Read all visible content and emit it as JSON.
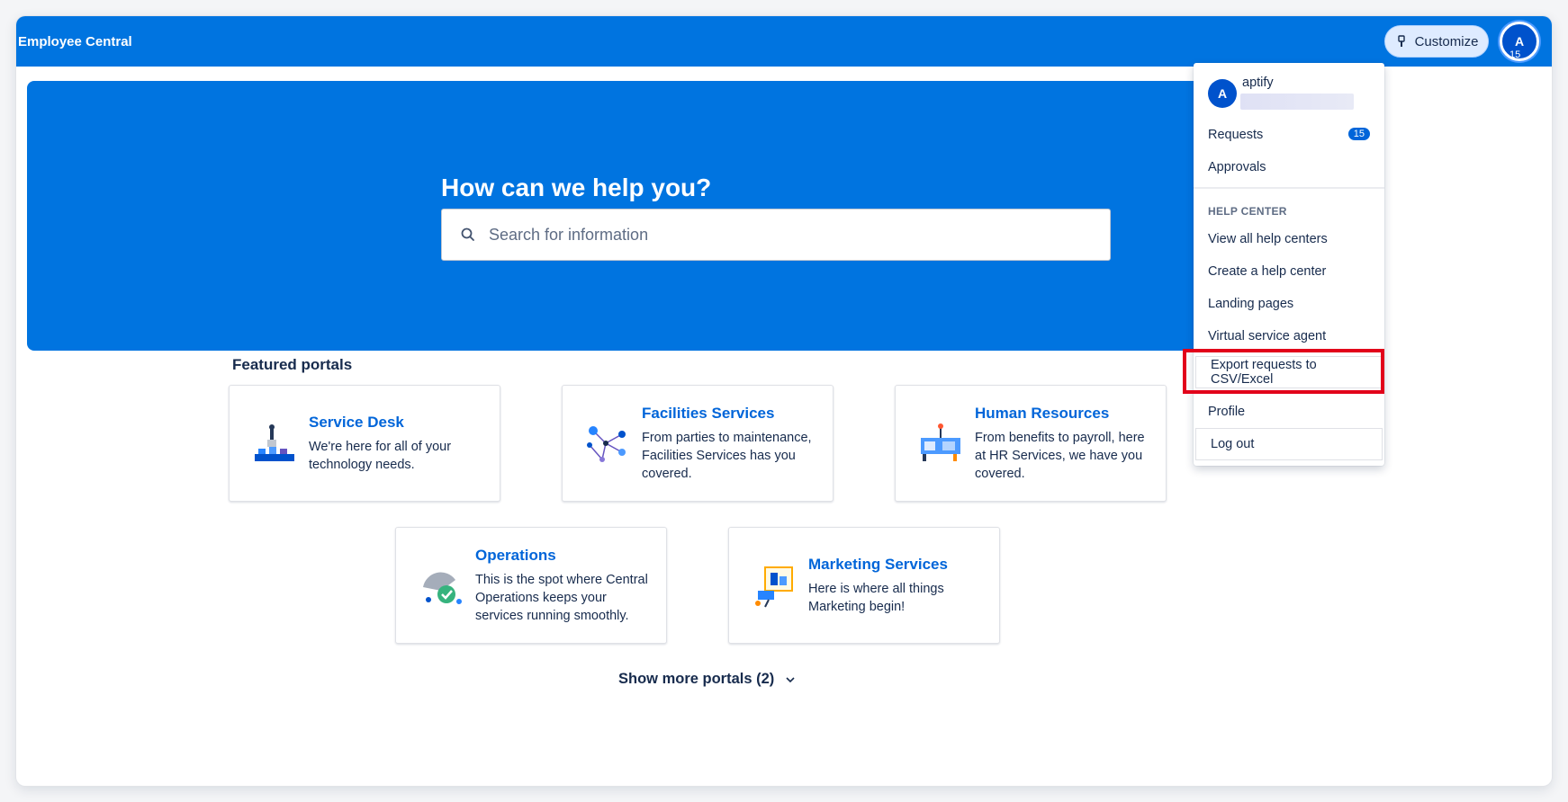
{
  "topbar": {
    "brand": "Employee Central",
    "customize_label": "Customize",
    "avatar_letter": "A",
    "avatar_count": "15"
  },
  "hero": {
    "title": "How can we help you?",
    "search_placeholder": "Search for information"
  },
  "featured": {
    "title": "Featured portals",
    "portals": [
      {
        "title": "Service Desk",
        "desc": "We're here for all of your technology needs."
      },
      {
        "title": "Facilities Services",
        "desc": "From parties to maintenance, Facilities Services has you covered."
      },
      {
        "title": "Human Resources",
        "desc": "From benefits to payroll, here at HR Services, we have you covered."
      },
      {
        "title": "Operations",
        "desc": "This is the spot where Central Operations keeps your services running smoothly."
      },
      {
        "title": "Marketing Services",
        "desc": "Here is where all things Marketing begin!"
      }
    ],
    "show_more_label": "Show more portals (2)"
  },
  "menu": {
    "avatar_letter": "A",
    "username": "aptify",
    "requests_label": "Requests",
    "requests_count": "15",
    "approvals_label": "Approvals",
    "help_center_heading": "HELP CENTER",
    "view_all_label": "View all help centers",
    "create_label": "Create a help center",
    "landing_label": "Landing pages",
    "virtual_agent_label": "Virtual service agent",
    "export_label": "Export requests to CSV/Excel",
    "profile_label": "Profile",
    "logout_label": "Log out"
  },
  "colors": {
    "brand_blue": "#0074e0",
    "link_blue": "#0065d9",
    "highlight_red": "#e2001a"
  }
}
